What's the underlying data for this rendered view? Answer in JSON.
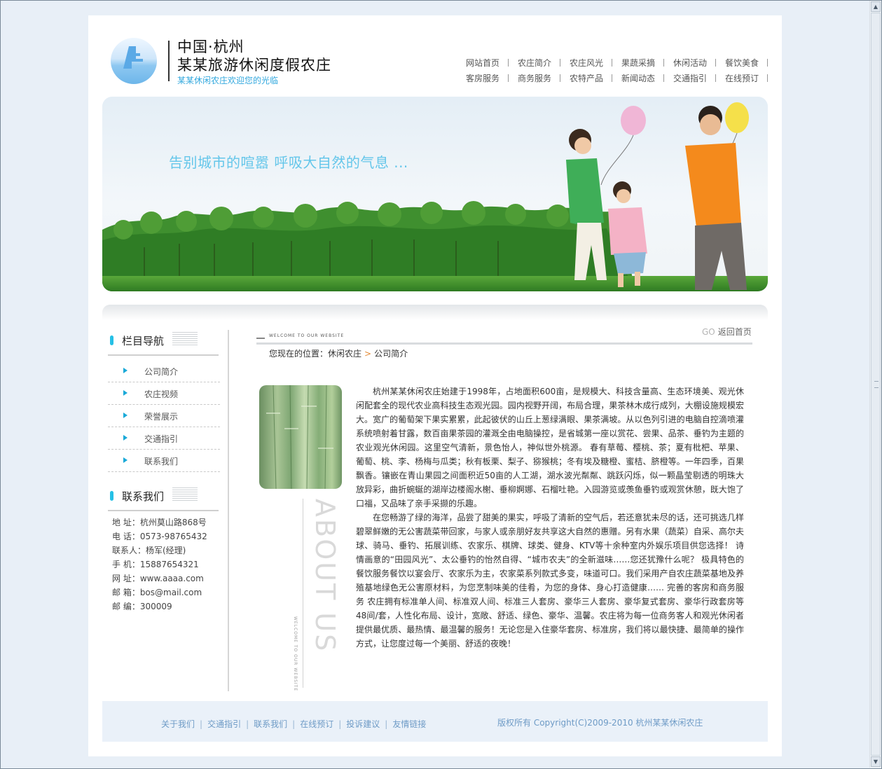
{
  "header": {
    "logo_line1": "中国·杭州",
    "logo_line2": "某某旅游休闲度假农庄",
    "logo_slogan": "某某休闲农庄欢迎您的光临",
    "nav_row1": [
      "网站首页",
      "农庄简介",
      "农庄风光",
      "果蔬采摘",
      "休闲活动",
      "餐饮美食"
    ],
    "nav_row2": [
      "客房服务",
      "商务服务",
      "农特产品",
      "新闻动态",
      "交通指引",
      "在线预订"
    ]
  },
  "banner": {
    "slogan": "告别城市的喧嚣 呼吸大自然的气息 ..."
  },
  "sidebar": {
    "nav_title": "栏目导航",
    "items": [
      "公司简介",
      "农庄视频",
      "荣誉展示",
      "交通指引",
      "联系我们"
    ],
    "contact_title": "联系我们",
    "contact": {
      "address": "地  址：杭州莫山路868号",
      "phone": "电  话：0573-98765432",
      "person": "联系人：杨军(经理)",
      "mobile": "手  机：15887654321",
      "website": "网  址：www.aaaa.com",
      "email": "邮  箱：bos@mail.com",
      "zip": "邮  编：300009"
    }
  },
  "content": {
    "welcome_tag": "WELCOME TO OUR WEBSITE",
    "go_label": "GO",
    "back_home": "返回首页",
    "breadcrumb_prefix": "您现在的位置：",
    "breadcrumb_parent": "休闲农庄",
    "breadcrumb_arrow": ">",
    "breadcrumb_current": "公司简介",
    "about_us": "ABOUT US",
    "welcome_vertical": "WELCOME TO OUR WEBSITE",
    "paragraph1": "杭州某某休闲农庄始建于1998年，占地面积600亩，是规模大、科技含量高、生态环境美、观光休闲配套全的现代农业高科技生态观光园。园内视野开阔，布局合理，果茶林木成行成列，大棚设施规模宏大。宽广的葡萄架下果实累累，此起彼伏的山丘上葱绿满眼、果茶满坡。从以色列引进的电脑自控滴喷灌系统喷射着甘露，数百亩果茶园的灌溉全由电脑操控，是省城第一座以赏花、尝果、品茶、垂钓为主题的农业观光休闲园。这里空气清新，景色怡人，神似世外桃源。 春有草莓、樱桃、茶；夏有枇杷、苹果、葡萄、桃、李、杨梅与瓜类；秋有板栗、梨子、猕猴桃；冬有埃及糖橙、蜜桔、脐橙等。一年四季，百果飘香。镶嵌在青山果园之间面积近50亩的人工湖，湖水波光粼粼、跳跃闪烁，似一颗晶莹剔透的明珠大放异彩，曲折蜿蜒的湖岸边楼阁水榭、垂柳婀娜、石榴吐艳。入园游览或羡鱼垂钓或观赏休憩，既大饱了口福，又品味了亲手采撷的乐趣。",
    "paragraph2": "在您畅游了绿的海洋，品尝了甜美的果实，呼吸了清新的空气后，若还意犹未尽的话，还可挑选几样碧翠鲜嫩的无公害蔬菜带回家，与家人或亲朋好友共享这大自然的惠赠。另有水果（蔬菜）自采、高尔夫球、骑马、垂钓、拓展训练、农家乐、棋牌、球类、健身、KTV等十余种室内外娱乐项目供您选择！ 诗情画意的“田园风光”、太公垂钓的怡然自得、“城市农夫”的全新滋味……您还犹豫什么呢？ 极具特色的餐饮服务餐饮以宴会厅、农家乐为主，农家菜系列款式多变，味道可口。我们采用产自农庄蔬菜基地及养殖基地绿色无公害原材料，为您烹制味美的佳肴，为您的身体、身心打造健康…… 完善的客房和商务服务 农庄拥有标准单人间、标准双人间、标准三人套房、豪华三人套房、豪华复式套房、豪华行政套房等48间/套，人性化布局、设计，宽敞、舒适、绿色、豪华、温馨。农庄将为每一位商务客人和观光休闲者提供最优质、最热情、最温馨的服务！无论您是入住豪华套房、标准房，我们将以最快捷、最简单的操作方式，让您度过每一个美丽、舒适的夜晚！"
  },
  "footer": {
    "links": [
      "关于我们",
      "交通指引",
      "联系我们",
      "在线预订",
      "投诉建议",
      "友情链接"
    ],
    "separator": "|",
    "copyright": "版权所有  Copyright(C)2009-2010 杭州某某休闲农庄"
  }
}
